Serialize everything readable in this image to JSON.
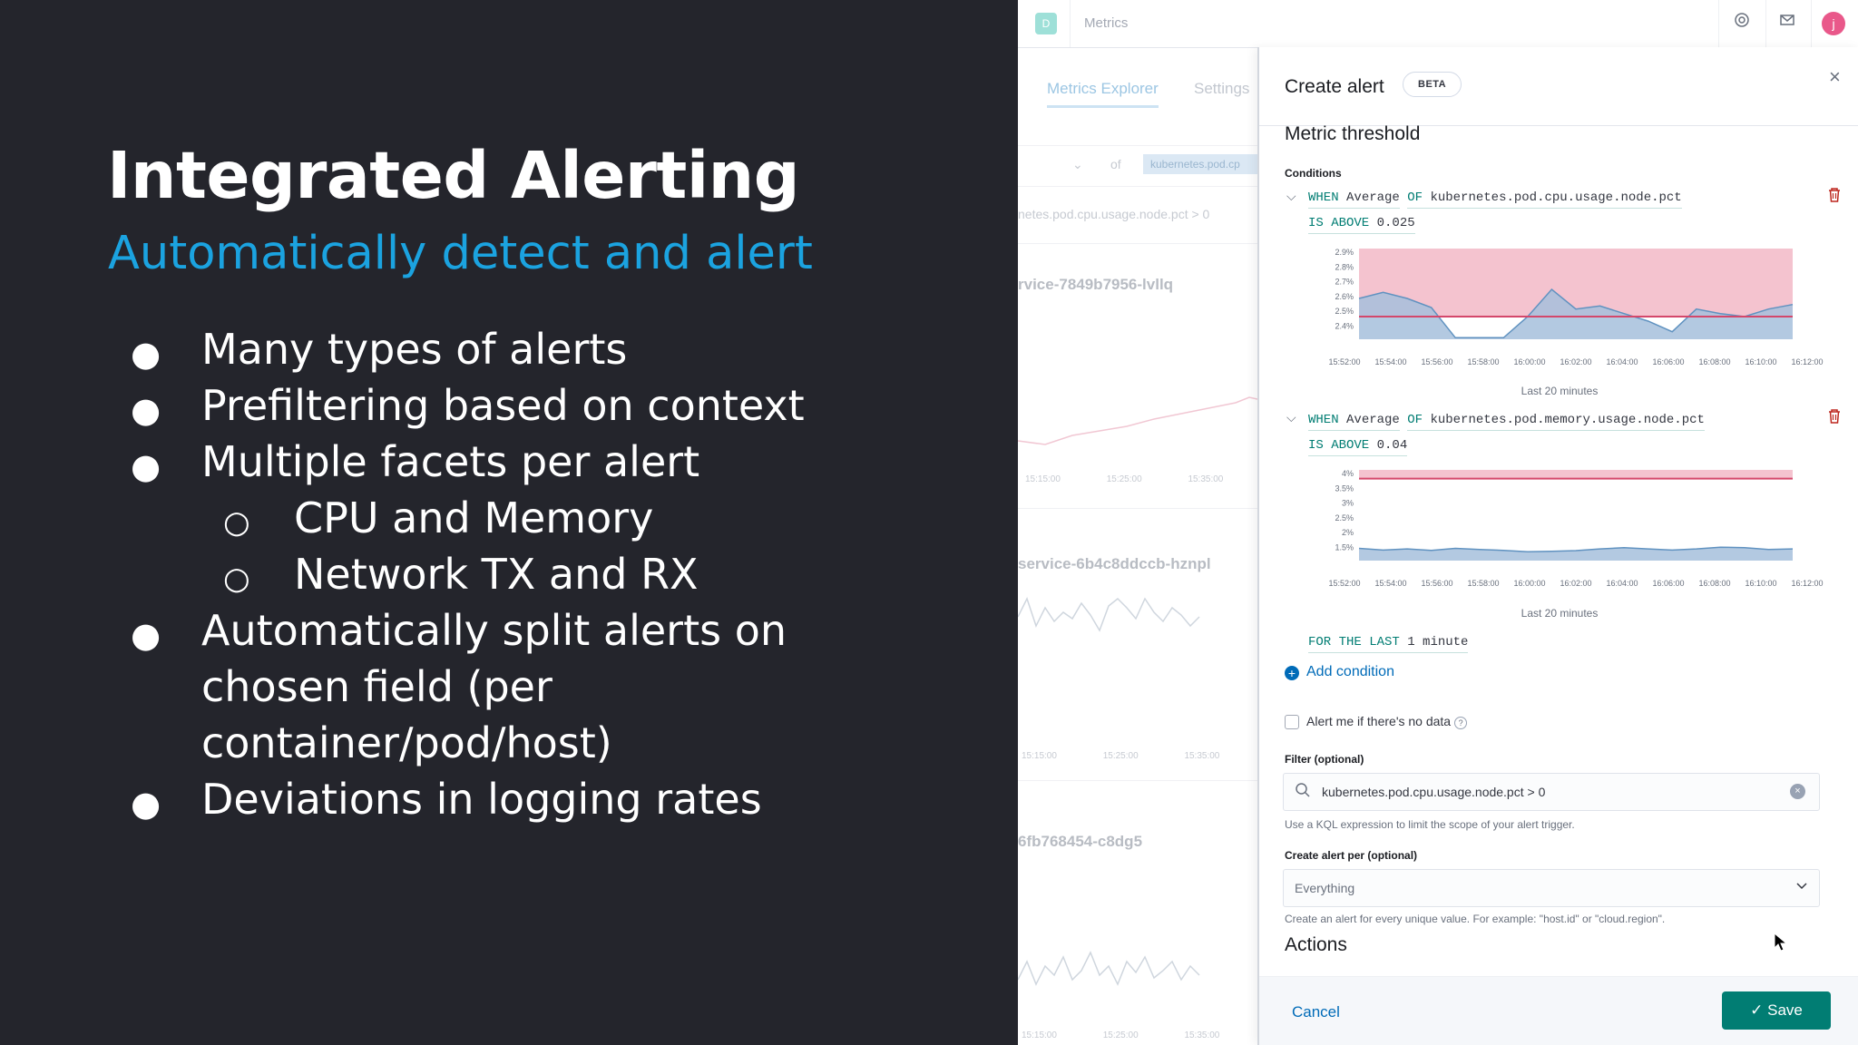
{
  "slide": {
    "title": "Integrated Alerting",
    "subtitle": "Automatically detect and alert",
    "bullets": [
      "Many types of alerts",
      "Prefiltering based on context",
      "Multiple facets per alert",
      "CPU and Memory",
      "Network TX and RX",
      "Automatically split alerts on",
      "chosen field (per",
      "container/pod/host)",
      "Deviations in logging rates"
    ],
    "bullet_glyph": "●",
    "sub_bullet_glyph": "○"
  },
  "topbar": {
    "logo_letter": "D",
    "title": "Metrics",
    "avatar_letter": "j"
  },
  "background_app": {
    "tabs": [
      "Metrics Explorer",
      "Settings"
    ],
    "of_label": "of",
    "filter_chip": "kubernetes.pod.cp",
    "filter_expr": "netes.pod.cpu.usage.node.pct > 0",
    "card_titles": [
      "rvice-7849b7956-lvllq",
      "service-6b4c8ddccb-hznpl",
      "6fb768454-c8dg5"
    ],
    "time_ticks": [
      "15:15:00",
      "15:25:00",
      "15:35:00"
    ]
  },
  "flyout": {
    "title": "Create alert",
    "beta": "BETA",
    "section_title": "Metric threshold",
    "conditions_label": "Conditions",
    "condition1": {
      "when": "WHEN",
      "agg": "Average",
      "of": "OF",
      "field": "kubernetes.pod.cpu.usage.node.pct",
      "comparator": "IS ABOVE",
      "threshold": "0.025"
    },
    "condition2": {
      "when": "WHEN",
      "agg": "Average",
      "of": "OF",
      "field": "kubernetes.pod.memory.usage.node.pct",
      "comparator": "IS ABOVE",
      "threshold": "0.04"
    },
    "chart_caption": "Last 20 minutes",
    "for_the_last": "FOR THE LAST",
    "duration": "1 minute",
    "add_condition": "Add condition",
    "no_data_label": "Alert me if there's no data",
    "filter_label": "Filter (optional)",
    "filter_value": "kubernetes.pod.cpu.usage.node.pct > 0",
    "filter_help": "Use a KQL expression to limit the scope of your alert trigger.",
    "group_label": "Create alert per (optional)",
    "group_value": "Everything",
    "group_help": "Create an alert for every unique value. For example: \"host.id\" or \"cloud.region\".",
    "actions_title": "Actions",
    "cancel": "Cancel",
    "save": "Save"
  },
  "chart_data": [
    {
      "type": "area",
      "x": [
        "15:52:00",
        "15:54:00",
        "15:56:00",
        "15:58:00",
        "16:00:00",
        "16:02:00",
        "16:04:00",
        "16:06:00",
        "16:08:00",
        "16:10:00",
        "16:12:00"
      ],
      "y_ticks": [
        "2.9%",
        "2.8%",
        "2.7%",
        "2.6%",
        "2.5%",
        "2.4%"
      ],
      "ylim": [
        2.35,
        2.95
      ],
      "threshold": 2.5,
      "series": [
        {
          "values": [
            2.62,
            2.66,
            2.62,
            2.56,
            2.36,
            2.36,
            2.36,
            2.5,
            2.68,
            2.55,
            2.57,
            2.52,
            2.47,
            2.4,
            2.55,
            2.52,
            2.5,
            2.55,
            2.58
          ]
        }
      ],
      "colors": {
        "area": "#a6bfdc",
        "line": "#6092c0",
        "threshold": "#d4476b",
        "alert_zone": "#f4c3cf"
      }
    },
    {
      "type": "area",
      "x": [
        "15:52:00",
        "15:54:00",
        "15:56:00",
        "15:58:00",
        "16:00:00",
        "16:02:00",
        "16:04:00",
        "16:06:00",
        "16:08:00",
        "16:10:00",
        "16:12:00"
      ],
      "y_ticks": [
        "4%",
        "3.5%",
        "3%",
        "2.5%",
        "2%",
        "1.5%"
      ],
      "ylim": [
        1.2,
        4.3
      ],
      "threshold": 4,
      "series": [
        {
          "values": [
            1.62,
            1.56,
            1.6,
            1.55,
            1.62,
            1.58,
            1.55,
            1.5,
            1.52,
            1.54,
            1.6,
            1.64,
            1.6,
            1.56,
            1.6,
            1.66,
            1.64,
            1.58,
            1.6
          ]
        }
      ],
      "colors": {
        "area": "#a6bfdc",
        "line": "#6092c0",
        "threshold": "#d4476b",
        "alert_zone": "#f4c3cf"
      }
    }
  ]
}
